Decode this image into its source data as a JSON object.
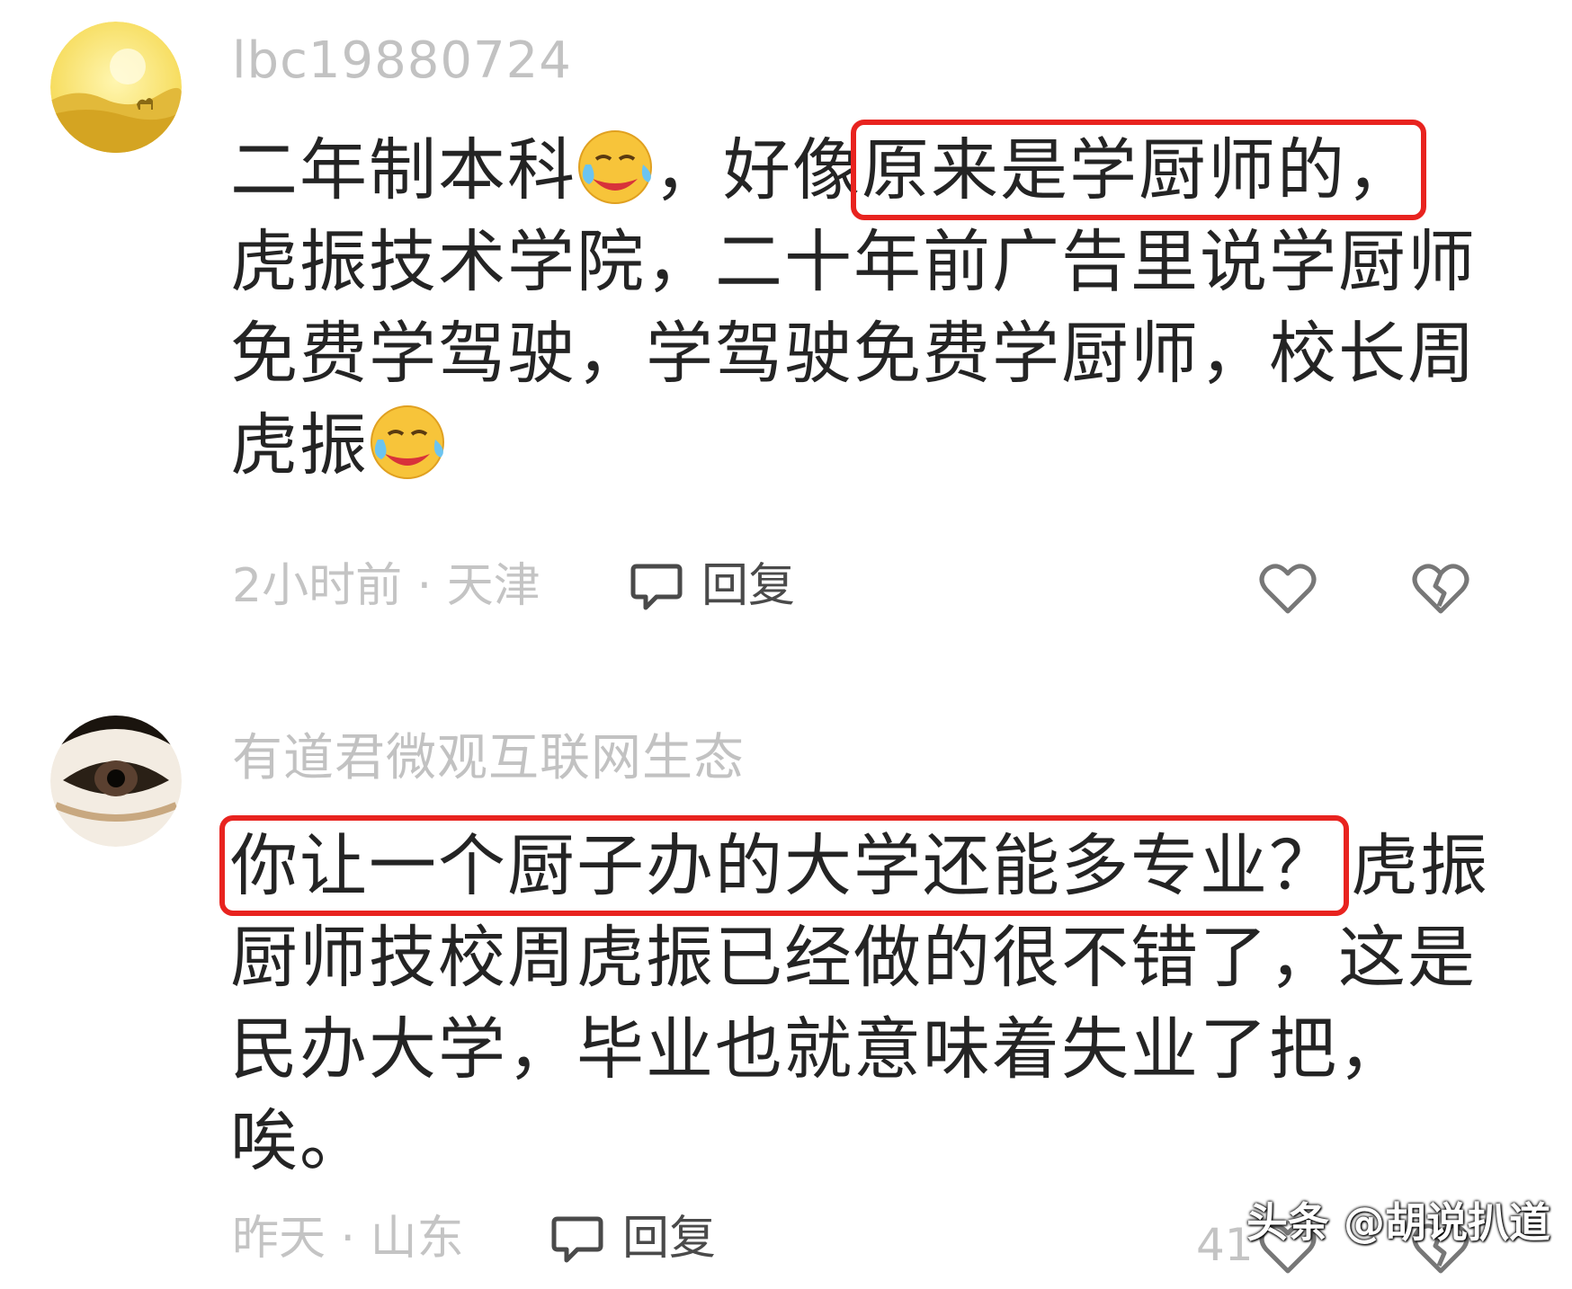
{
  "comments": [
    {
      "username": "lbc19880724",
      "text": {
        "part1": "二年制本科",
        "part2": "，好像",
        "highlight": "原来是学厨师的，",
        "part3": "虎振技术学院，二十年前广告里说学厨师免费学驾驶，学驾驶免费学厨师，校长周虎振"
      },
      "emoji": "crying-laughing-emoji",
      "time": "2小时前",
      "separator": "·",
      "location": "天津",
      "reply_label": "回复"
    },
    {
      "username": "有道君微观互联网生态",
      "text": {
        "highlight": "你让一个厨子办的大学还能多专业？",
        "part1": "虎振厨师技校周虎振已经做的很不错了，这是民办大学，毕业也就意味着失业了把，唉。"
      },
      "time": "昨天",
      "separator": "·",
      "location": "山东",
      "reply_label": "回复",
      "like_count": "41"
    }
  ],
  "watermark": "头条 @胡说扒道",
  "colors": {
    "highlight_box": "#e8231f",
    "meta_text": "#c4c4c4"
  },
  "icons": [
    "avatar-desert",
    "avatar-eye",
    "crying-laughing-emoji",
    "comment-bubble-icon",
    "heart-icon",
    "broken-heart-icon"
  ]
}
